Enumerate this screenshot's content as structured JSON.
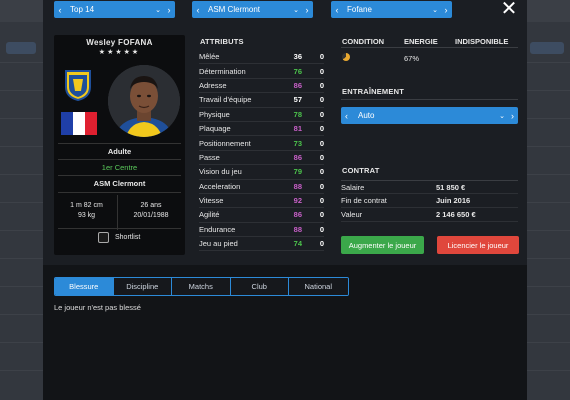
{
  "background": {
    "left_tab_label": "",
    "right_tab_label": ""
  },
  "selectors": {
    "league": "Top 14",
    "club": "ASM Clermont",
    "player": "Fofane"
  },
  "player_card": {
    "name": "Wesley FOFANA",
    "stars": "★★★★★",
    "age_group": "Adulte",
    "position": "1er Centre",
    "club": "ASM Clermont",
    "height": "1 m 82  cm",
    "weight": "93 kg",
    "age": "26 ans",
    "birth_date": "20/01/1988",
    "shortlist_label": "Shortlist"
  },
  "attributes": {
    "title": "ATTRIBUTS",
    "rows": [
      {
        "name": "Mêlée",
        "value": "36",
        "progress": "0",
        "color": "white"
      },
      {
        "name": "Détermination",
        "value": "76",
        "progress": "0",
        "color": "green"
      },
      {
        "name": "Adresse",
        "value": "86",
        "progress": "0",
        "color": "pink"
      },
      {
        "name": "Travail d'équipe",
        "value": "57",
        "progress": "0",
        "color": "white"
      },
      {
        "name": "Physique",
        "value": "78",
        "progress": "0",
        "color": "green"
      },
      {
        "name": "Plaquage",
        "value": "81",
        "progress": "0",
        "color": "pink"
      },
      {
        "name": "Positionnement",
        "value": "73",
        "progress": "0",
        "color": "green"
      },
      {
        "name": "Passe",
        "value": "86",
        "progress": "0",
        "color": "pink"
      },
      {
        "name": "Vision du jeu",
        "value": "79",
        "progress": "0",
        "color": "green"
      },
      {
        "name": "Acceleration",
        "value": "88",
        "progress": "0",
        "color": "pink"
      },
      {
        "name": "Vitesse",
        "value": "92",
        "progress": "0",
        "color": "pink"
      },
      {
        "name": "Agilité",
        "value": "86",
        "progress": "0",
        "color": "pink"
      },
      {
        "name": "Endurance",
        "value": "88",
        "progress": "0",
        "color": "pink"
      },
      {
        "name": "Jeu au pied",
        "value": "74",
        "progress": "0",
        "color": "green"
      }
    ]
  },
  "condition": {
    "headers": {
      "condition": "CONDITION",
      "energy": "ENERGIE",
      "unavailable": "INDISPONIBLE"
    },
    "energy_value": "67%",
    "condition_level": 0.65
  },
  "training": {
    "title": "ENTRAÎNEMENT",
    "value": "Auto"
  },
  "contract": {
    "title": "CONTRAT",
    "rows": [
      {
        "key": "Salaire",
        "value": "51 850 €"
      },
      {
        "key": "Fin de contrat",
        "value": "Juin 2016"
      },
      {
        "key": "Valeur",
        "value": "2 146 650 €"
      }
    ]
  },
  "buttons": {
    "increase": "Augmenter le joueur",
    "release": "Licencier le joueur"
  },
  "tabs": [
    "Blessure",
    "Discipline",
    "Matchs",
    "Club",
    "National"
  ],
  "active_tab": "Blessure",
  "tab_content": "Le joueur n'est pas blessé",
  "colors": {
    "accent": "#2c8ad8",
    "green_button": "#3ba84a",
    "red_button": "#e0473c",
    "attr_green": "#4cc34c",
    "attr_pink": "#c860c8"
  }
}
